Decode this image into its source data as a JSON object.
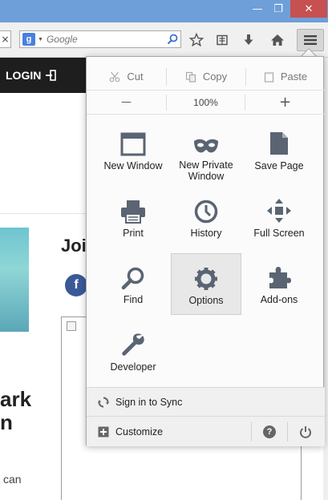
{
  "window": {
    "minimize_glyph": "—",
    "maximize_glyph": "❐",
    "close_glyph": "✕"
  },
  "toolbar": {
    "close_tab_glyph": "×",
    "search": {
      "engine_badge": "g",
      "placeholder": "Google"
    },
    "icons": [
      "bookmark-star-icon",
      "reading-list-icon",
      "downloads-icon",
      "home-icon",
      "hamburger-menu-icon"
    ]
  },
  "page": {
    "login_label": "LOGIN",
    "join_heading": "Joi",
    "facebook_letter": "f",
    "heading_fragment_1": "ark",
    "heading_fragment_2": "n",
    "body_fragment": "can"
  },
  "menu": {
    "edit": {
      "cut": "Cut",
      "copy": "Copy",
      "paste": "Paste"
    },
    "zoom": {
      "out": "—",
      "level": "100%",
      "in": "+"
    },
    "items": [
      {
        "label": "New Window",
        "icon": "new-window-icon"
      },
      {
        "label": "New Private Window",
        "icon": "private-mask-icon"
      },
      {
        "label": "Save Page",
        "icon": "save-page-icon"
      },
      {
        "label": "Print",
        "icon": "printer-icon"
      },
      {
        "label": "History",
        "icon": "clock-icon"
      },
      {
        "label": "Full Screen",
        "icon": "fullscreen-icon"
      },
      {
        "label": "Find",
        "icon": "magnifier-icon"
      },
      {
        "label": "Options",
        "icon": "gear-icon"
      },
      {
        "label": "Add-ons",
        "icon": "puzzle-icon"
      },
      {
        "label": "Developer",
        "icon": "wrench-icon"
      }
    ],
    "active_item": "Options",
    "sync_label": "Sign in to Sync",
    "customize_label": "Customize",
    "help_glyph": "?",
    "quit_glyph": "⏻"
  },
  "colors": {
    "titlebar": "#6f9fd8",
    "close": "#c75050",
    "icon": "#5a6472",
    "page_nav": "#1e1e1e"
  }
}
